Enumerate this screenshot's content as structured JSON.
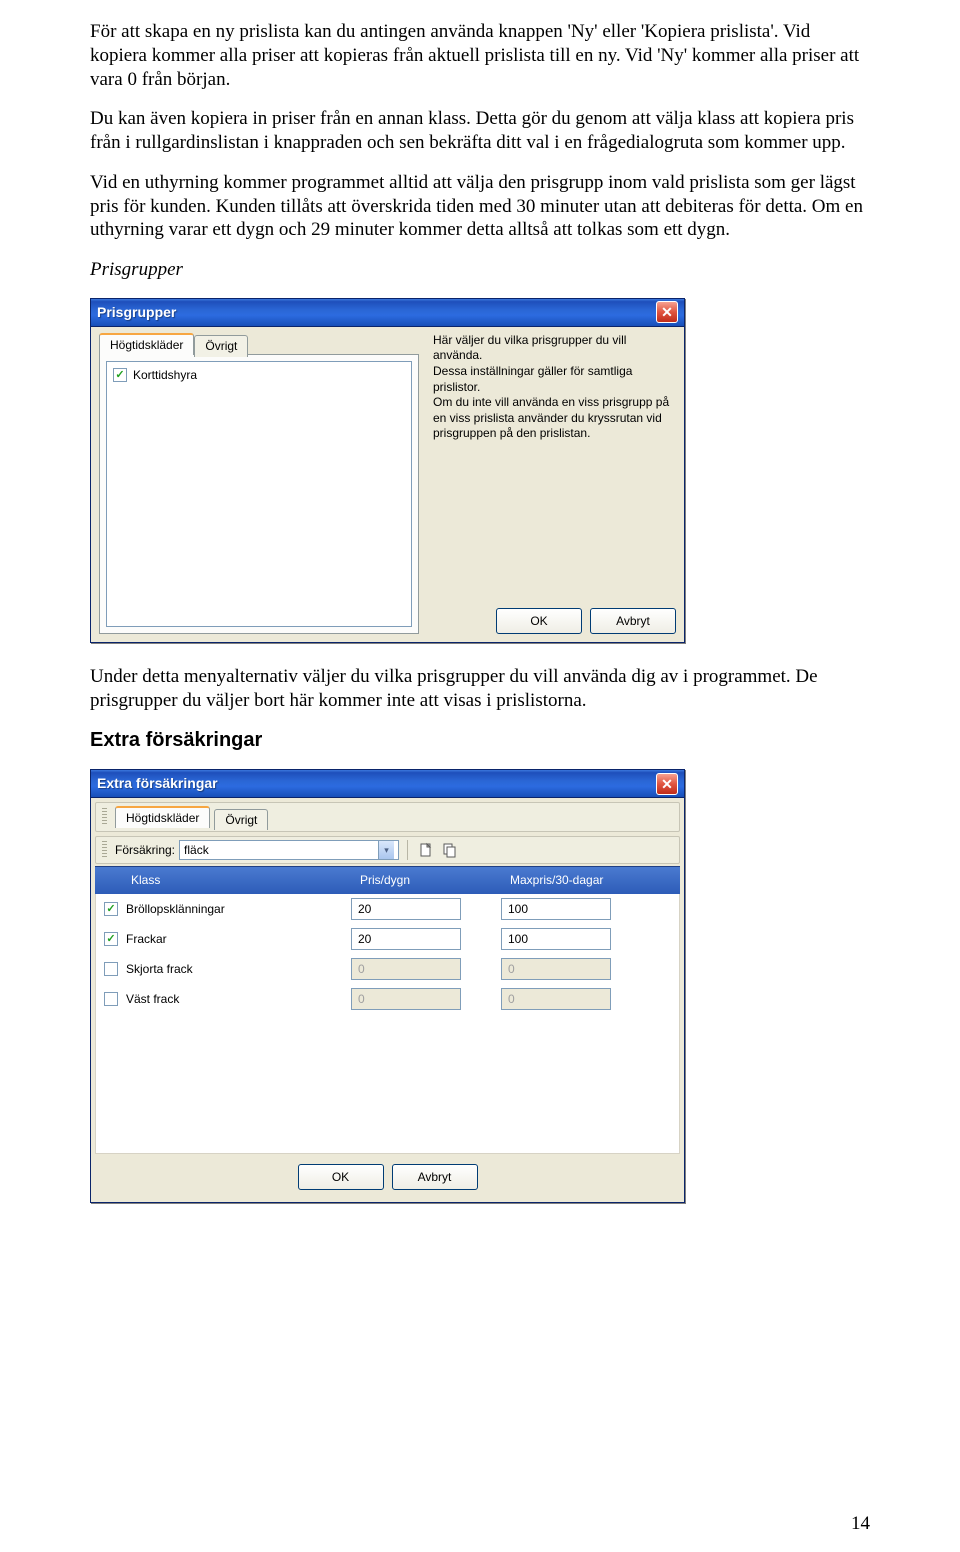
{
  "para1": "För att skapa en ny prislista kan du antingen använda knappen 'Ny' eller 'Kopiera prislista'. Vid kopiera kommer alla priser att kopieras från aktuell prislista till en ny. Vid 'Ny' kommer alla priser att vara 0 från början.",
  "para2": "Du kan även kopiera in priser från en annan klass. Detta gör du genom att välja klass att kopiera pris från i rullgardinslistan i knappraden och sen bekräfta ditt val i en frågedialogruta som kommer upp.",
  "para3": "Vid en uthyrning kommer programmet alltid att välja den prisgrupp inom vald prislista som ger lägst pris för kunden. Kunden tillåts att överskrida tiden med 30 minuter utan att debiteras för detta. Om en uthyrning varar ett dygn och 29 minuter kommer detta alltså att tolkas som ett dygn.",
  "prisgrupper_heading": "Prisgrupper",
  "dialog1": {
    "title": "Prisgrupper",
    "tabs": [
      "Högtidskläder",
      "Övrigt"
    ],
    "listItems": [
      {
        "label": "Korttidshyra",
        "checked": true
      }
    ],
    "info": "Här väljer du vilka prisgrupper du vill använda.\nDessa inställningar gäller för samtliga prislistor.\nOm du inte vill använda en viss prisgrupp på en viss prislista använder du kryssrutan vid prisgruppen på den prislistan.",
    "ok": "OK",
    "cancel": "Avbryt"
  },
  "para4": "Under detta menyalternativ väljer du vilka prisgrupper du vill använda dig av i programmet. De prisgrupper du väljer bort här kommer inte att visas i prislistorna.",
  "extra_heading": "Extra försäkringar",
  "dialog2": {
    "title": "Extra försäkringar",
    "tabs": [
      "Högtidskläder",
      "Övrigt"
    ],
    "toolbar": {
      "label": "Försäkring:",
      "value": "fläck"
    },
    "headers": {
      "klass": "Klass",
      "pris": "Pris/dygn",
      "max": "Maxpris/30-dagar"
    },
    "rows": [
      {
        "label": "Bröllopsklänningar",
        "checked": true,
        "pris": "20",
        "max": "100"
      },
      {
        "label": "Frackar",
        "checked": true,
        "pris": "20",
        "max": "100"
      },
      {
        "label": "Skjorta frack",
        "checked": false,
        "pris": "0",
        "max": "0"
      },
      {
        "label": "Väst frack",
        "checked": false,
        "pris": "0",
        "max": "0"
      }
    ],
    "ok": "OK",
    "cancel": "Avbryt"
  },
  "page_number": "14"
}
